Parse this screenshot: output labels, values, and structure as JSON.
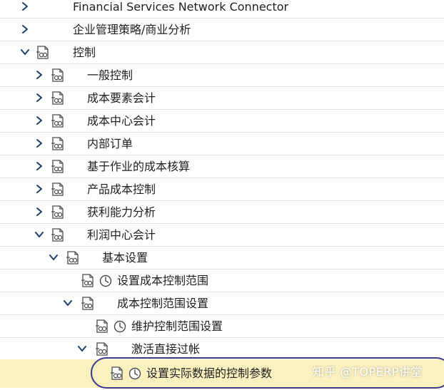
{
  "tree": [
    {
      "label": "Financial Services Network Connector",
      "level": 0,
      "arrow": "right",
      "icons": []
    },
    {
      "label": "企业管理策略/商业分析",
      "level": 0,
      "arrow": "right",
      "icons": []
    },
    {
      "label": "控制",
      "level": 0,
      "arrow": "down",
      "icons": [
        "img-icon"
      ]
    },
    {
      "label": "一般控制",
      "level": 1,
      "arrow": "right",
      "icons": [
        "img-icon"
      ]
    },
    {
      "label": "成本要素会计",
      "level": 1,
      "arrow": "right",
      "icons": [
        "img-icon"
      ]
    },
    {
      "label": "成本中心会计",
      "level": 1,
      "arrow": "right",
      "icons": [
        "img-icon"
      ]
    },
    {
      "label": "内部订单",
      "level": 1,
      "arrow": "right",
      "icons": [
        "img-icon"
      ]
    },
    {
      "label": "基于作业的成本核算",
      "level": 1,
      "arrow": "right",
      "icons": [
        "img-icon"
      ]
    },
    {
      "label": "产品成本控制",
      "level": 1,
      "arrow": "right",
      "icons": [
        "img-icon"
      ]
    },
    {
      "label": "获利能力分析",
      "level": 1,
      "arrow": "right",
      "icons": [
        "img-icon"
      ]
    },
    {
      "label": "利润中心会计",
      "level": 1,
      "arrow": "down",
      "icons": [
        "img-icon"
      ]
    },
    {
      "label": "基本设置",
      "level": 2,
      "arrow": "down",
      "icons": [
        "img-icon"
      ]
    },
    {
      "label": "设置成本控制范围",
      "level": 3,
      "arrow": "none",
      "icons": [
        "img-icon",
        "clock-icon"
      ]
    },
    {
      "label": "成本控制范围设置",
      "level": 3,
      "arrow": "down",
      "icons": [
        "img-icon"
      ]
    },
    {
      "label": "维护控制范围设置",
      "level": 4,
      "arrow": "none",
      "icons": [
        "img-icon",
        "clock-icon"
      ]
    },
    {
      "label": "激活直接过帐",
      "level": 4,
      "arrow": "down",
      "icons": [
        "img-icon"
      ]
    },
    {
      "label": "设置实际数据的控制参数",
      "level": 5,
      "arrow": "none",
      "icons": [
        "img-icon",
        "clock-icon"
      ],
      "highlighted": true
    }
  ],
  "watermark": "知乎 @TOPERP讲堂",
  "colors": {
    "highlight_bg": "#fbf1bf",
    "ellipse_border": "#3c3a8c",
    "arrow": "#1a3f6b",
    "icon_stroke": "#4a4a4a"
  }
}
